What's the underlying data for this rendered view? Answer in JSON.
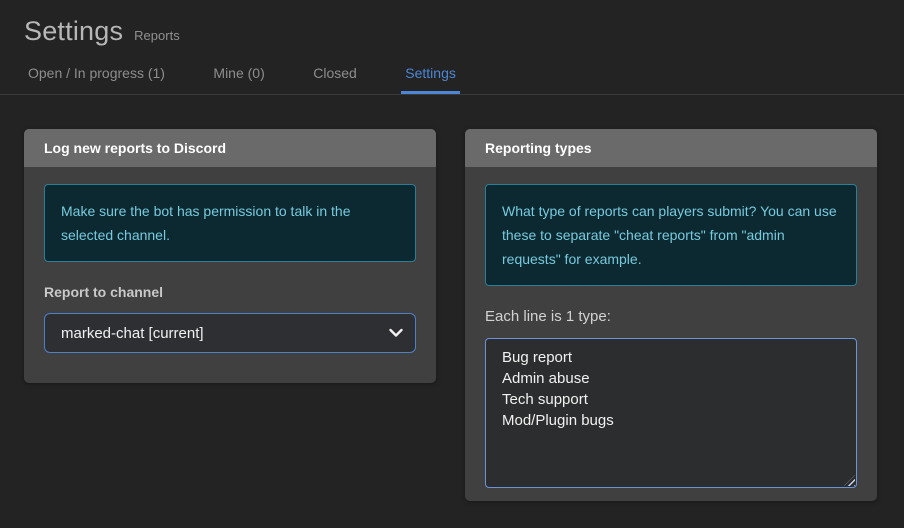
{
  "page": {
    "title": "Settings",
    "subtitle": "Reports"
  },
  "tabs": [
    {
      "label": "Open / In progress (1)",
      "active": false
    },
    {
      "label": "Mine (0)",
      "active": false
    },
    {
      "label": "Closed",
      "active": false
    },
    {
      "label": "Settings",
      "active": true
    }
  ],
  "cards": {
    "discord": {
      "title": "Log new reports to Discord",
      "info": "Make sure the bot has permission to talk in the selected channel.",
      "channel_label": "Report to channel",
      "channel_value": "marked-chat [current]"
    },
    "reporting_types": {
      "title": "Reporting types",
      "info": "What type of reports can players submit? You can use these to separate \"cheat reports\" from \"admin requests\" for example.",
      "types_label": "Each line is 1 type:",
      "types_value": "Bug report\nAdmin abuse\nTech support\nMod/Plugin bugs"
    }
  },
  "colors": {
    "accent_blue": "#4d86d5",
    "info_teal_text": "#76cbde",
    "info_teal_border": "#2d7e94",
    "info_teal_bg": "#0c2830",
    "card_bg": "#404040",
    "card_header_bg": "#6a6a6a",
    "page_bg": "#232323"
  }
}
